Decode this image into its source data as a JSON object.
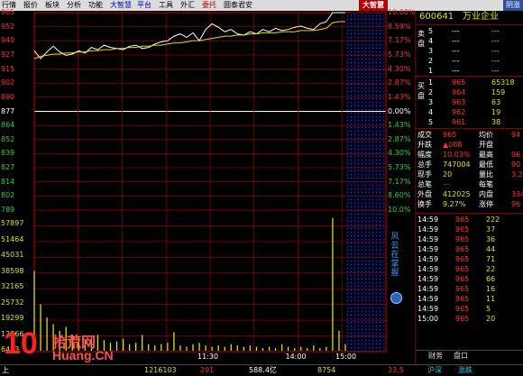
{
  "menu": {
    "items": [
      "行情",
      "报价",
      "板块",
      "分析",
      "功能",
      "大智慧",
      "平台",
      "工具",
      "外汇",
      "委托",
      "圆泰君安"
    ],
    "logo": "大智慧",
    "right_button": "阴涨"
  },
  "colors": {
    "up": "#ff3030",
    "down": "#30d030",
    "price_line": "#ffffff",
    "avg_line": "#e0e000",
    "grid": "#a00000"
  },
  "chart": {
    "price_labels": [
      "965",
      "952",
      "940",
      "927",
      "915",
      "902",
      "890",
      "877",
      "864",
      "852",
      "839",
      "827",
      "814",
      "802",
      "789"
    ],
    "pct_labels": [
      "10.00%",
      "8.59%",
      "7.17%",
      "5.73%",
      "4.30%",
      "2.87%",
      "1.43%",
      "0.00%",
      "1.43%",
      "2.87%",
      "4.30%",
      "5.73%",
      "7.17%",
      "8.60%",
      "10.0%"
    ],
    "vol_labels": [
      "57897",
      "51464",
      "45031",
      "38598",
      "32165",
      "25732",
      "19299",
      "12866",
      "6433"
    ],
    "time_labels": [
      "11:30",
      "14:00",
      "15:00"
    ],
    "vertical_tag": "风云在掌握",
    "price_series": [
      931,
      924,
      930,
      935,
      930,
      927,
      928,
      931,
      929,
      934,
      932,
      936,
      934,
      933,
      932,
      935,
      936,
      933,
      934,
      937,
      939,
      940,
      944,
      946,
      943,
      947,
      940,
      950,
      955,
      952,
      948,
      950,
      946,
      945,
      948,
      946,
      950,
      948,
      951,
      949,
      950,
      952,
      953,
      951,
      950,
      955,
      957,
      965,
      965,
      965
    ],
    "avg_series": [
      924,
      926,
      927,
      928,
      928,
      929,
      929,
      930,
      930,
      931,
      931,
      932,
      932,
      933,
      933,
      934,
      934,
      935,
      935,
      936,
      936,
      937,
      938,
      938,
      939,
      940,
      940,
      941,
      942,
      943,
      944,
      944,
      945,
      945,
      946,
      946,
      947,
      947,
      947,
      948,
      948,
      948,
      949,
      949,
      949,
      950,
      951,
      956,
      957,
      957
    ],
    "volume_series": [
      0.6,
      0.35,
      0.25,
      0.2,
      0.15,
      0.18,
      0.12,
      0.1,
      0.08,
      0.1,
      0.12,
      0.08,
      0.06,
      0.07,
      0.09,
      0.05,
      0.06,
      0.12,
      0.05,
      0.04,
      0.05,
      0.06,
      0.14,
      0.04,
      0.03,
      0.05,
      0.06,
      0.04,
      0.03,
      0.04,
      0.03,
      0.05,
      0.04,
      0.03,
      0.04,
      0.03,
      0.02,
      0.03,
      0.02,
      0.05,
      0.03,
      0.02,
      0.03,
      0.02,
      0.04,
      0.02,
      0.03,
      1.0,
      0.15,
      0.05
    ]
  },
  "panel": {
    "stock_code": "600641",
    "stock_name": "万业企业",
    "sell_tag": "卖盘",
    "buy_tag": "买盘",
    "sell_rows": [
      {
        "lvl": "5",
        "price": "---",
        "vol": "---"
      },
      {
        "lvl": "4",
        "price": "---",
        "vol": "---"
      },
      {
        "lvl": "3",
        "price": "---",
        "vol": "---"
      },
      {
        "lvl": "2",
        "price": "---",
        "vol": "---"
      },
      {
        "lvl": "1",
        "price": "---",
        "vol": "---"
      }
    ],
    "buy_rows": [
      {
        "lvl": "1",
        "price": "965",
        "vol": "65318"
      },
      {
        "lvl": "2",
        "price": "964",
        "vol": "159"
      },
      {
        "lvl": "3",
        "price": "963",
        "vol": "63"
      },
      {
        "lvl": "4",
        "price": "962",
        "vol": "19"
      },
      {
        "lvl": "5",
        "price": "961",
        "vol": "38"
      }
    ],
    "stats": [
      {
        "k": "成交",
        "v": "965",
        "k2": "均价",
        "v2": "94"
      },
      {
        "k": "升跌",
        "v": "▲088",
        "k2": "开盘",
        "v2": ""
      },
      {
        "k": "幅度",
        "v": "10.03%",
        "k2": "最高",
        "v2": "96"
      },
      {
        "k": "总手",
        "v": "747004",
        "k2": "最低",
        "v2": "90"
      },
      {
        "k": "现手",
        "v": "20",
        "k2": "量比",
        "v2": "3.2"
      },
      {
        "k": "总笔",
        "v": "---",
        "k2": "每笔",
        "v2": ""
      },
      {
        "k": "外盘",
        "v": "412025",
        "k2": "内盘",
        "v2": "33497"
      },
      {
        "k": "换手",
        "v": "9.27%",
        "k2": "涨停",
        "v2": "96"
      }
    ],
    "ticks": [
      {
        "t": "14:59",
        "p": "965",
        "v": "222"
      },
      {
        "t": "14:59",
        "p": "965",
        "v": "37"
      },
      {
        "t": "14:59",
        "p": "965",
        "v": "36"
      },
      {
        "t": "14:59",
        "p": "965",
        "v": "44"
      },
      {
        "t": "14:59",
        "p": "965",
        "v": "71"
      },
      {
        "t": "14:59",
        "p": "965",
        "v": "22"
      },
      {
        "t": "14:59",
        "p": "965",
        "v": "66"
      },
      {
        "t": "14:59",
        "p": "965",
        "v": "16"
      },
      {
        "t": "14:59",
        "p": "965",
        "v": "11"
      },
      {
        "t": "14:59",
        "p": "965",
        "v": "5"
      },
      {
        "t": "15:00",
        "p": "965",
        "v": "20"
      }
    ],
    "bottom_tabs": [
      "财务",
      "盘口"
    ]
  },
  "statusbar": {
    "items": [
      "上",
      "1216103",
      "291",
      "588.4亿",
      "8754",
      "33.5",
      "沪深",
      "涨跌"
    ]
  },
  "watermark": {
    "brand": "10",
    "name_cn": "拾荒网",
    "url": "Huang.CN"
  }
}
